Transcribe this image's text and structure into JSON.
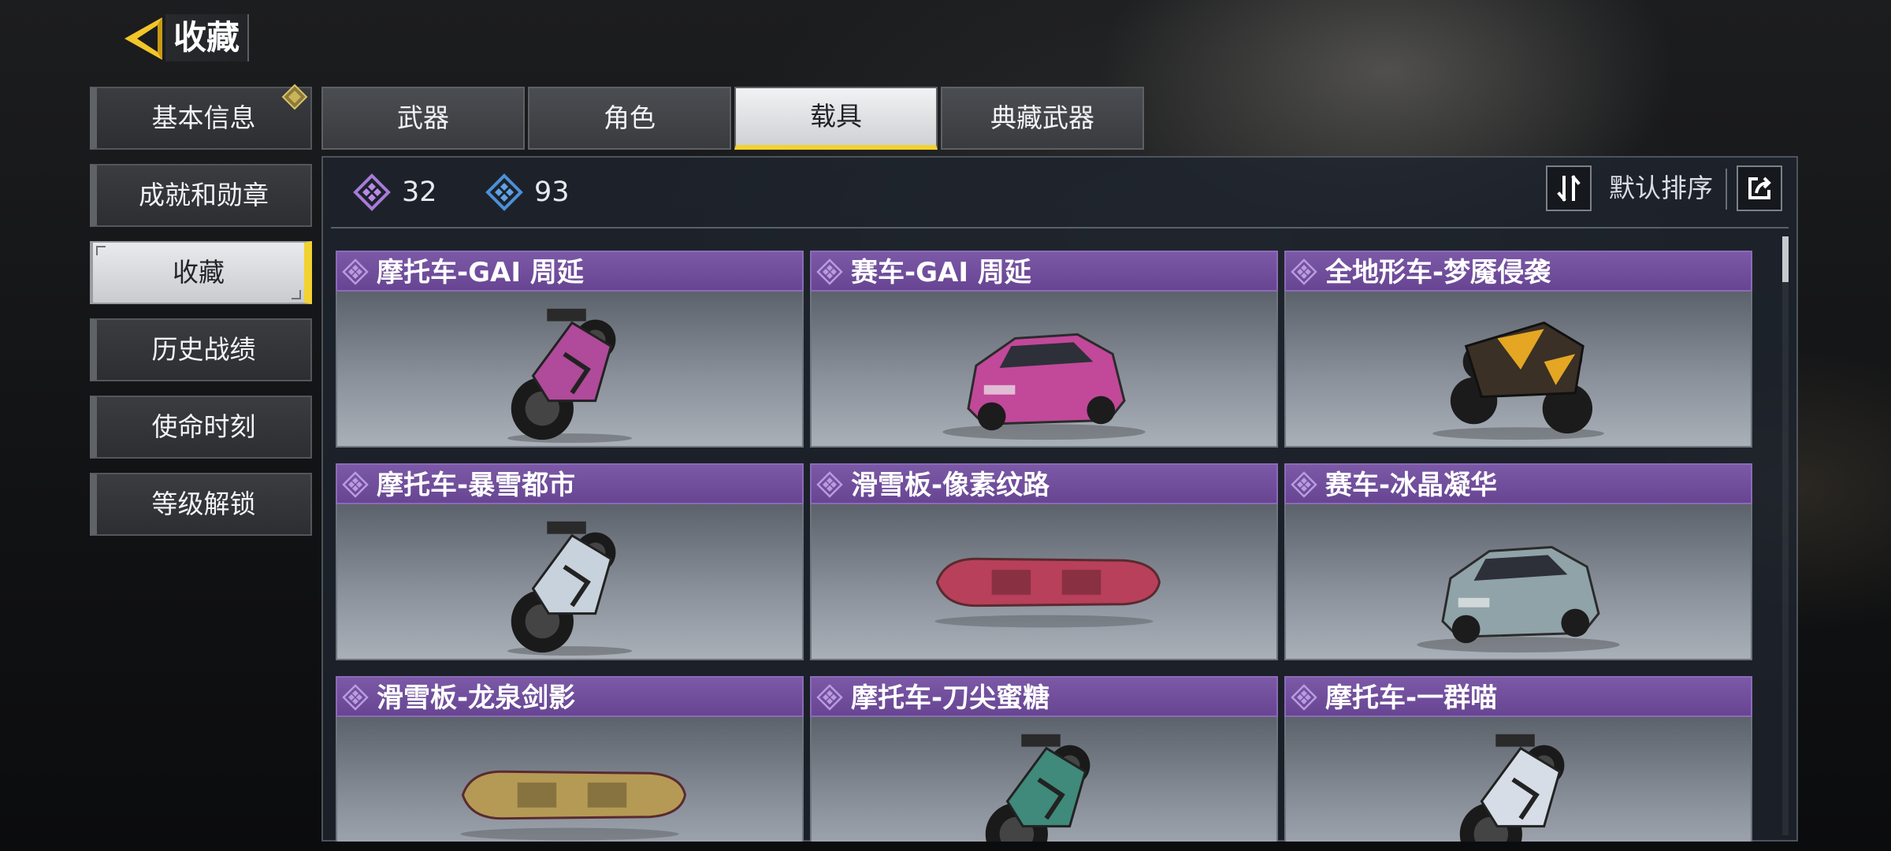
{
  "header": {
    "title": "收藏"
  },
  "sidebar": {
    "items": [
      {
        "label": "基本信息",
        "active": false
      },
      {
        "label": "成就和勋章",
        "active": false
      },
      {
        "label": "收藏",
        "active": true
      },
      {
        "label": "历史战绩",
        "active": false
      },
      {
        "label": "使命时刻",
        "active": false
      },
      {
        "label": "等级解锁",
        "active": false
      }
    ]
  },
  "tabs": [
    {
      "label": "武器",
      "active": false
    },
    {
      "label": "角色",
      "active": false
    },
    {
      "label": "载具",
      "active": true
    },
    {
      "label": "典藏武器",
      "active": false
    }
  ],
  "counts": {
    "purple": {
      "icon": "purple-diamond-icon",
      "value": "32"
    },
    "blue": {
      "icon": "blue-diamond-icon",
      "value": "93"
    }
  },
  "sort": {
    "label": "默认排序"
  },
  "items": [
    {
      "title": "摩托车-GAI 周延",
      "vehicle": "motorcycle",
      "color": "#b04a9a"
    },
    {
      "title": "赛车-GAI 周延",
      "vehicle": "car",
      "color": "#c2489a"
    },
    {
      "title": "全地形车-梦魇侵袭",
      "vehicle": "atv",
      "color": "#3a3026"
    },
    {
      "title": "摩托车-暴雪都市",
      "vehicle": "motorcycle",
      "color": "#c8d2dc"
    },
    {
      "title": "滑雪板-像素纹路",
      "vehicle": "snowboard",
      "color": "#b8405a"
    },
    {
      "title": "赛车-冰晶凝华",
      "vehicle": "car",
      "color": "#8fa3a8"
    },
    {
      "title": "滑雪板-龙泉剑影",
      "vehicle": "snowboard",
      "color": "#b59a55"
    },
    {
      "title": "摩托车-刀尖蜜糖",
      "vehicle": "motorcycle",
      "color": "#3f8a7a"
    },
    {
      "title": "摩托车-一群喵",
      "vehicle": "motorcycle",
      "color": "#d6dde6"
    }
  ],
  "colors": {
    "accent": "#f2d230",
    "card_header": "#7b59a7",
    "purple_rarity": "#a77bd9",
    "blue_rarity": "#4d8fd6"
  }
}
